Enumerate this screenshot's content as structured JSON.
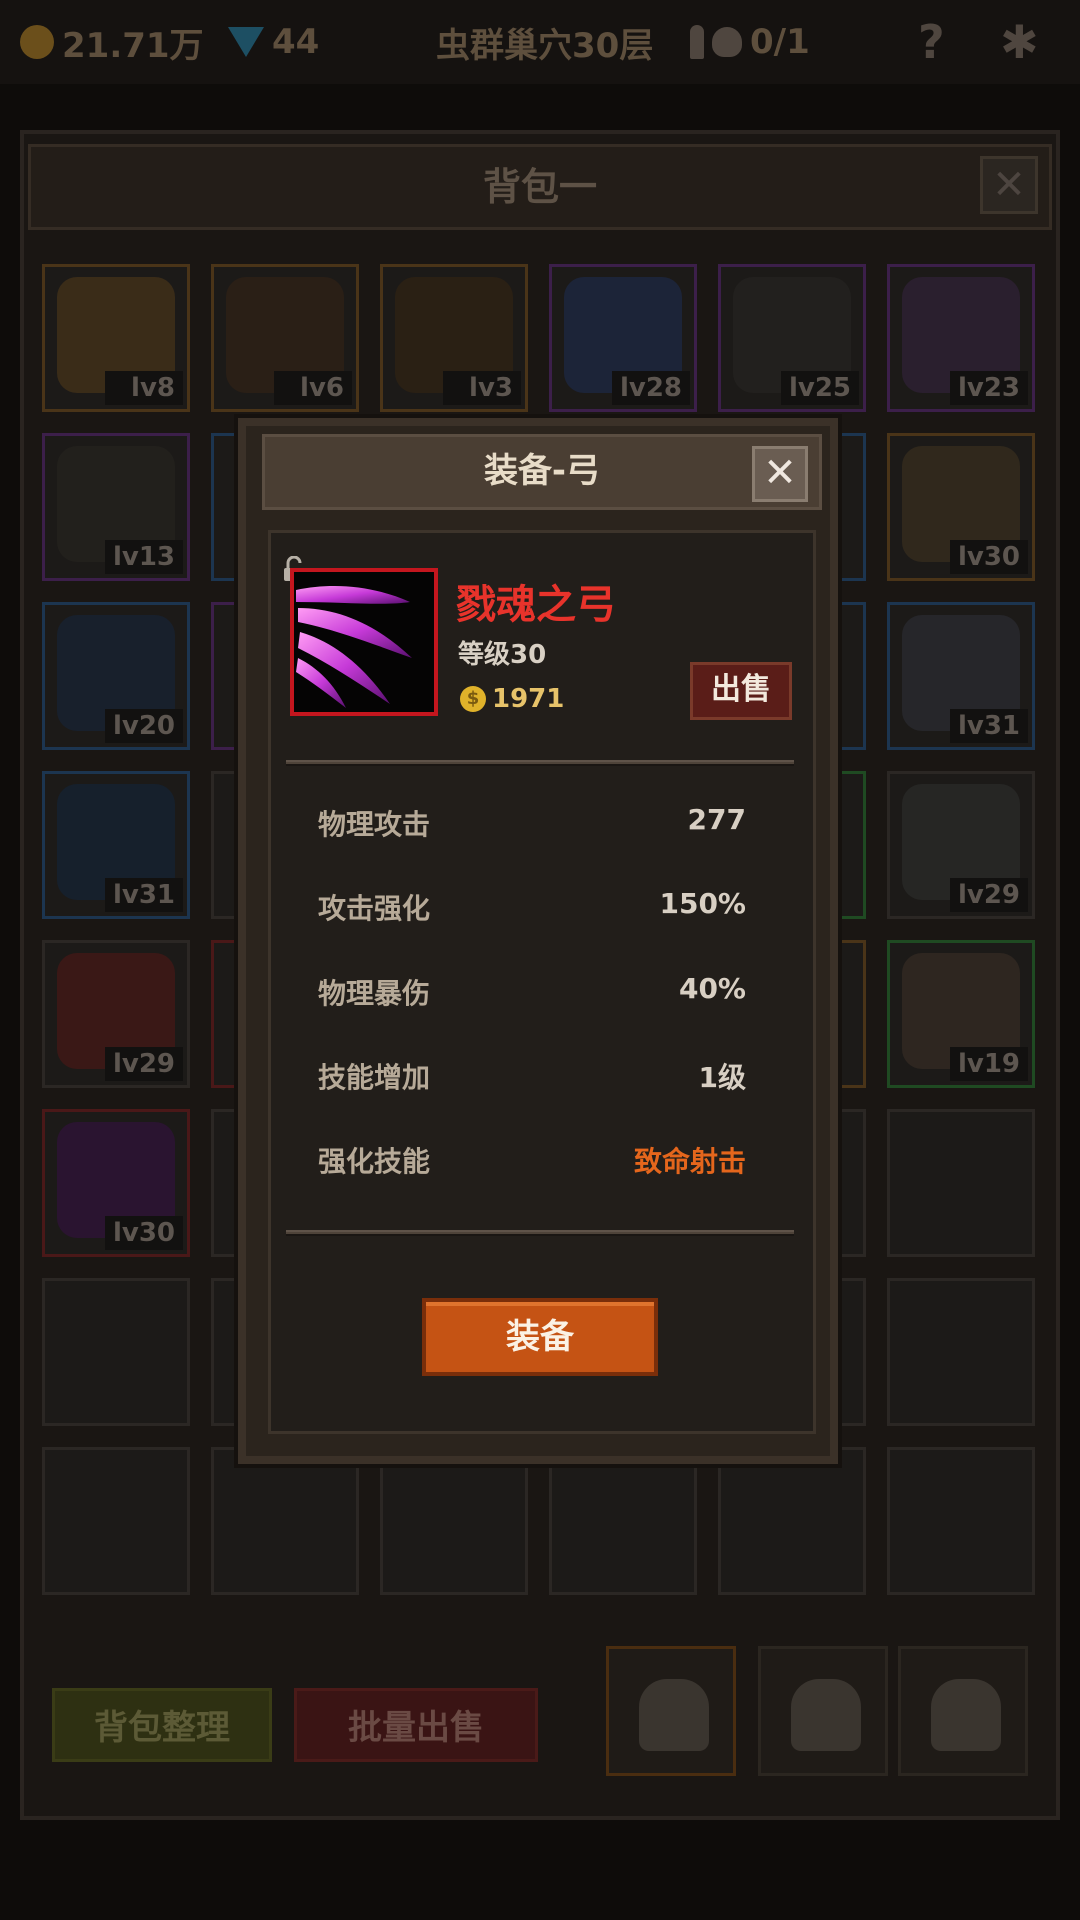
{
  "topbar": {
    "gold": "21.71万",
    "gems": "44",
    "location": "虫群巢穴30层",
    "skull_count": "0/1",
    "help": "?"
  },
  "backpack": {
    "title": "背包一",
    "close": "✕",
    "slots": [
      {
        "lv": "lv8"
      },
      {
        "lv": "lv6"
      },
      {
        "lv": "lv3"
      },
      {
        "lv": "lv28"
      },
      {
        "lv": "lv25"
      },
      {
        "lv": "lv23"
      },
      {
        "lv": "lv13"
      },
      {
        "lv": "lv30"
      },
      {
        "lv": "lv20"
      },
      {
        "lv": "lv31"
      },
      {
        "lv": "lv31"
      },
      {
        "lv": "lv29"
      },
      {
        "lv": "lv29"
      },
      {
        "lv": "lv19"
      },
      {
        "lv": "lv30"
      }
    ],
    "sort_button": "背包整理",
    "bulk_sell_button": "批量出售"
  },
  "dialog": {
    "title": "装备-弓",
    "close": "✕",
    "item_name": "戮魂之弓",
    "item_level": "等级30",
    "price": "1971",
    "coin_symbol": "$",
    "sell_button": "出售",
    "stats": [
      {
        "label": "物理攻击",
        "value": "277"
      },
      {
        "label": "攻击强化",
        "value": "150%"
      },
      {
        "label": "物理暴伤",
        "value": "40%"
      },
      {
        "label": "技能增加",
        "value": "1级"
      },
      {
        "label": "强化技能",
        "value": "致命射击"
      }
    ],
    "equip_button": "装备"
  },
  "colors": {
    "item_name": "#e8332b",
    "rarity_border": "#c4161e",
    "skill_highlight": "#e5661c",
    "equip_button": "#c55314"
  }
}
